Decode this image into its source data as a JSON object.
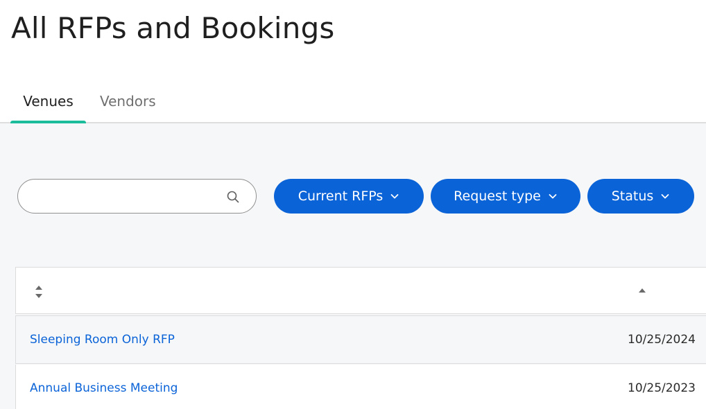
{
  "page": {
    "title": "All RFPs and Bookings"
  },
  "tabs": [
    {
      "label": "Venues",
      "active": true
    },
    {
      "label": "Vendors",
      "active": false
    }
  ],
  "search": {
    "value": "",
    "placeholder": ""
  },
  "filters": {
    "current_rfps": "Current RFPs",
    "request_type": "Request type",
    "status": "Status"
  },
  "table": {
    "rows": [
      {
        "name": "Sleeping Room Only RFP",
        "date": "10/25/2024"
      },
      {
        "name": "Annual Business Meeting",
        "date": "10/25/2023"
      }
    ]
  },
  "colors": {
    "accent": "#0b63d8",
    "tab_underline": "#1abc9c",
    "content_bg": "#f6f7f8"
  }
}
